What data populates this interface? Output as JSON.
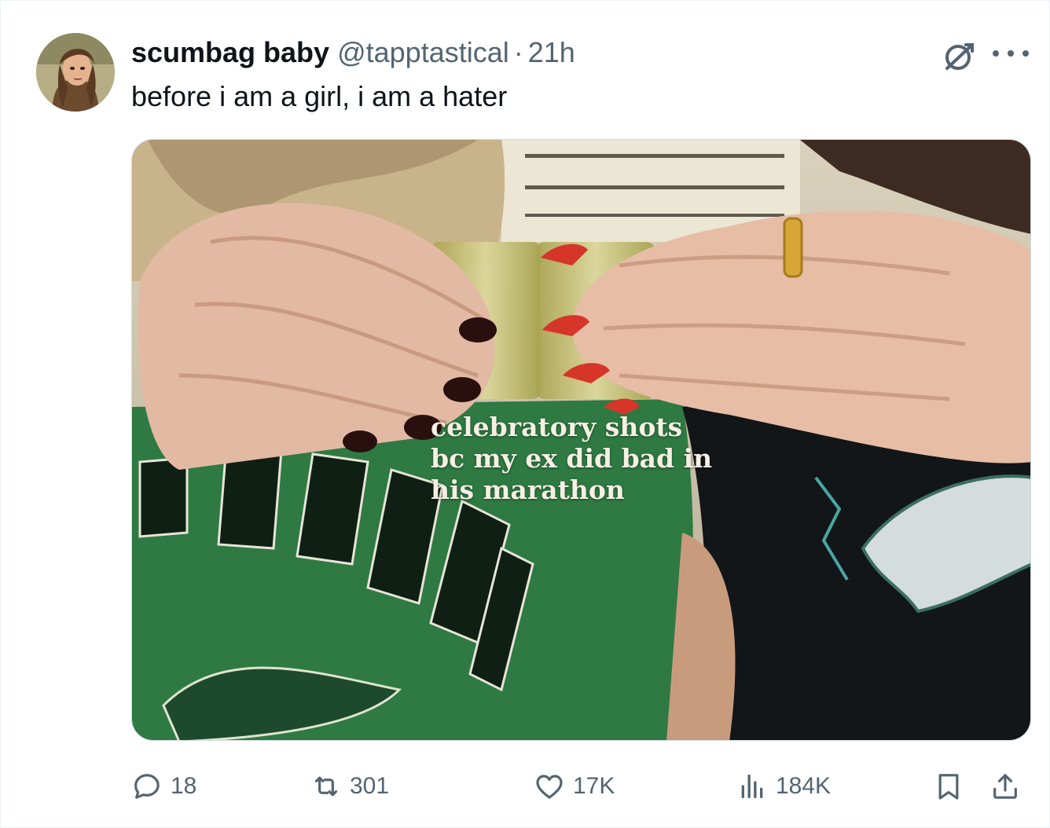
{
  "author": {
    "display_name": "scumbag baby",
    "handle": "@tapptastical",
    "separator": "·",
    "time_ago": "21h",
    "avatar_icon": "avatar-image"
  },
  "tweet": {
    "text": "before i am a girl, i am a hater"
  },
  "media": {
    "caption_lines": [
      "celebratory shots",
      "bc my ex did bad in",
      "his marathon"
    ],
    "shirt_text": "AGLES"
  },
  "metrics": {
    "replies": "18",
    "retweets": "301",
    "likes": "17K",
    "views": "184K"
  },
  "icons": {
    "grok": "grok-icon",
    "more": "more-icon",
    "reply": "reply-icon",
    "retweet": "retweet-icon",
    "like": "heart-icon",
    "views": "views-icon",
    "bookmark": "bookmark-icon",
    "share": "share-icon"
  },
  "colors": {
    "text_primary": "#0f1419",
    "text_secondary": "#536471",
    "border": "#cfd9de"
  }
}
